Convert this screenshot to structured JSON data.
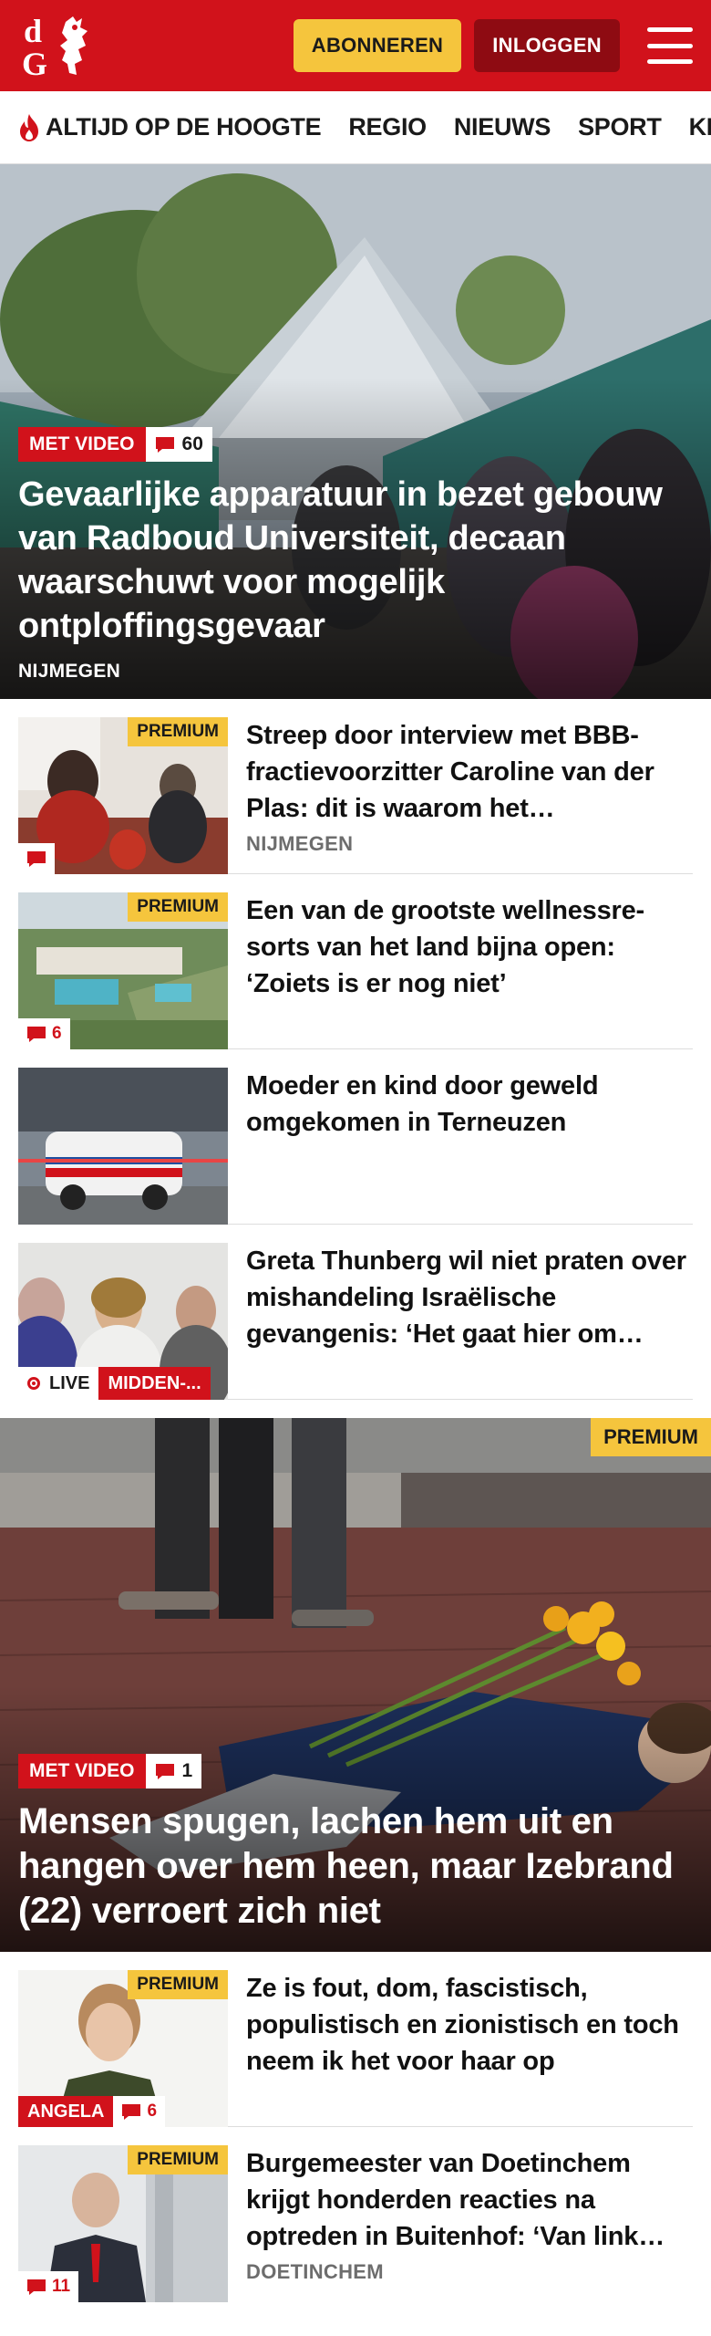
{
  "header": {
    "subscribe_label": "ABONNEREN",
    "login_label": "INLOGGEN",
    "brand_color": "#d1121b",
    "accent_color": "#f5c53d"
  },
  "nav": {
    "items": [
      "ALTIJD OP DE HOOGTE",
      "REGIO",
      "NIEUWS",
      "SPORT",
      "KIJK"
    ]
  },
  "hero": {
    "tag": "MET VIDEO",
    "comments": "60",
    "title": "Gevaarlijke apparatuur in bezet gebouw van Radboud Universiteit, decaan waarschuwt voor mogelijk ontploffingsgevaar",
    "location": "NIJMEGEN"
  },
  "articles": [
    {
      "badge": "PREMIUM",
      "comments": "",
      "title": "Streep door interview met BBB-fractievoorzitter Caroline van der Plas: dit is waarom het…",
      "location": "NIJMEGEN"
    },
    {
      "badge": "PREMIUM",
      "comments": "6",
      "title": "Een van de grootste wellnessre­sorts van het land bijna open: ‘Zoiets is er nog niet’",
      "location": ""
    },
    {
      "badge": "",
      "comments": "",
      "title": "Moeder en kind door geweld omgekomen in Terneuzen",
      "location": ""
    },
    {
      "badge": "",
      "live": "LIVE",
      "category": "MIDDEN-...",
      "title": "Greta Thunberg wil niet praten over mishandeling Israëlische gevangenis: ‘Het gaat hier om…",
      "location": ""
    }
  ],
  "feature": {
    "badge": "PREMIUM",
    "tag": "MET VIDEO",
    "comments": "1",
    "title": "Mensen spugen, lachen hem uit en hangen over hem heen, maar Izebrand (22) verroert zich niet"
  },
  "articles2": [
    {
      "badge": "PREMIUM",
      "author": "ANGELA",
      "comments": "6",
      "title": "Ze is fout, dom, fascistisch, populistisch en zionistisch en toch neem ik het voor haar op",
      "location": ""
    },
    {
      "badge": "PREMIUM",
      "comments": "11",
      "title": "Burgemeester van Doetinchem krijgt honderden reacties na optreden in Buitenhof: ‘Van link…",
      "location": "DOETINCHEM"
    }
  ]
}
